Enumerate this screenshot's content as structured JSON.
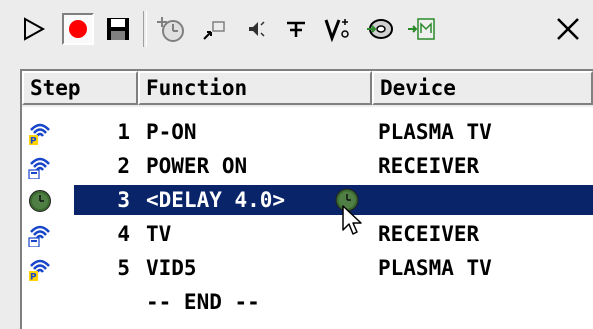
{
  "toolbar": {
    "buttons": [
      {
        "name": "play",
        "icon": "play-icon"
      },
      {
        "name": "record",
        "icon": "record-icon",
        "pressed": true,
        "color": "#ff0000"
      },
      {
        "name": "save",
        "icon": "floppy-disk-icon"
      },
      {
        "name": "add-delay",
        "icon": "clock-add-icon"
      },
      {
        "name": "jump",
        "icon": "arrow-box-icon"
      },
      {
        "name": "mute",
        "icon": "speaker-icon"
      },
      {
        "name": "text",
        "icon": "text-t-icon"
      },
      {
        "name": "volume",
        "icon": "volume-v-icon"
      },
      {
        "name": "macro",
        "icon": "disc-arrow-icon"
      },
      {
        "name": "insert",
        "icon": "insert-m-icon"
      },
      {
        "name": "delete",
        "icon": "close-x-icon"
      }
    ]
  },
  "table": {
    "columns": [
      "Step",
      "Function",
      "Device"
    ],
    "rows": [
      {
        "step": "1",
        "function": "P-ON",
        "device": "PLASMA TV",
        "icon": "wireless-p-icon",
        "selected": false
      },
      {
        "step": "2",
        "function": "POWER ON",
        "device": "RECEIVER",
        "icon": "wireless-r-icon",
        "selected": false
      },
      {
        "step": "3",
        "function": "<DELAY 4.0>",
        "device": "",
        "icon": "clock-icon",
        "selected": true
      },
      {
        "step": "4",
        "function": "TV",
        "device": "RECEIVER",
        "icon": "wireless-r-icon",
        "selected": false
      },
      {
        "step": "5",
        "function": "VID5",
        "device": "PLASMA TV",
        "icon": "wireless-p-icon",
        "selected": false
      }
    ],
    "end_label": "-- END --"
  },
  "colors": {
    "selection": "#0a246a",
    "wifi_blue": "#1846c8",
    "badge_yellow": "#ffd400",
    "clock_green": "#3a6a2e"
  }
}
